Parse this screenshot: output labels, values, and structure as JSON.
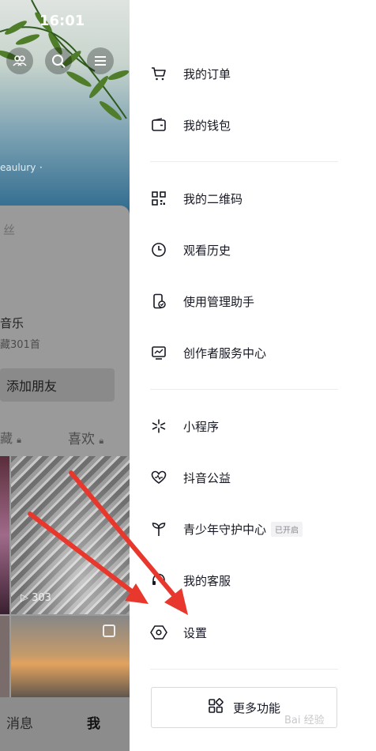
{
  "status_bar": {
    "time": "16:01"
  },
  "profile": {
    "uid_text": "eaulury 𐄁",
    "fans_label": "丝",
    "music_title": "音乐",
    "music_count": "藏301首",
    "add_friend_label": "添加朋友",
    "tab_favorites": "藏",
    "tab_likes": "喜欢",
    "video_play_count": "303",
    "bottom_nav": {
      "messages": "消息",
      "me": "我"
    }
  },
  "drawer": {
    "items": [
      {
        "label": "我的订单",
        "icon": "cart-icon"
      },
      {
        "label": "我的钱包",
        "icon": "wallet-icon"
      },
      {
        "label": "我的二维码",
        "icon": "qrcode-icon"
      },
      {
        "label": "观看历史",
        "icon": "clock-icon"
      },
      {
        "label": "使用管理助手",
        "icon": "phone-manage-icon"
      },
      {
        "label": "创作者服务中心",
        "icon": "chart-monitor-icon"
      },
      {
        "label": "小程序",
        "icon": "asterisk-icon"
      },
      {
        "label": "抖音公益",
        "icon": "heart-pulse-icon"
      },
      {
        "label": "青少年守护中心",
        "icon": "sprout-icon",
        "badge": "已开启"
      },
      {
        "label": "我的客服",
        "icon": "headset-icon"
      },
      {
        "label": "设置",
        "icon": "settings-hexagon-icon"
      }
    ],
    "more_button": {
      "label": "更多功能",
      "icon": "apps-icon"
    }
  },
  "watermark": "Bai 经验",
  "colors": {
    "annotation_arrow": "#e8372c",
    "text": "#161823",
    "badge_text": "#8a8b91"
  }
}
